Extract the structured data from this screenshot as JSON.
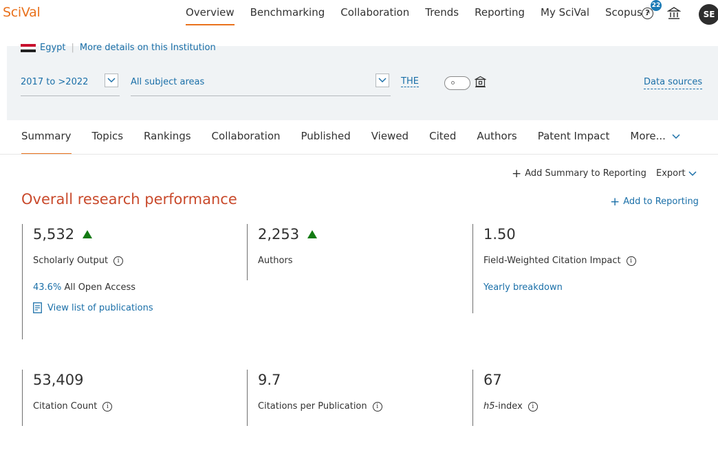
{
  "app": {
    "logo": "SciVal"
  },
  "nav": {
    "items": [
      "Overview",
      "Benchmarking",
      "Collaboration",
      "Trends",
      "Reporting",
      "My SciVal"
    ],
    "scopus": "Scopus",
    "scopus_ext": "↗",
    "help_badge": "22",
    "avatar": "SE"
  },
  "filters": {
    "country": "Egypt",
    "details_link": "More details on this Institution",
    "year_range": "2017 to >2022",
    "subject": "All subject areas",
    "ranking": "THE",
    "data_sources": "Data sources"
  },
  "tabs": {
    "items": [
      "Summary",
      "Topics",
      "Rankings",
      "Collaboration",
      "Published",
      "Viewed",
      "Cited",
      "Authors",
      "Patent Impact"
    ],
    "more": "More..."
  },
  "actions": {
    "add_summary": "Add Summary to Reporting",
    "export": "Export",
    "add_reporting": "Add to Reporting"
  },
  "section": {
    "title": "Overall research performance"
  },
  "metrics": {
    "scholarly_output": {
      "value": "5,532",
      "label": "Scholarly Output",
      "oa_pct": "43.6%",
      "oa_label": "All Open Access",
      "link": "View list of publications"
    },
    "authors": {
      "value": "2,253",
      "label": "Authors"
    },
    "fwci": {
      "value": "1.50",
      "label": "Field-Weighted Citation Impact",
      "link": "Yearly breakdown"
    },
    "citation_count": {
      "value": "53,409",
      "label": "Citation Count"
    },
    "citations_per_pub": {
      "value": "9.7",
      "label": "Citations per Publication"
    },
    "h5": {
      "value": "67",
      "label_italic": "h5",
      "label_rest": "-index"
    }
  },
  "colors": {
    "accent": "#e9711c",
    "link": "#1a6fa8",
    "title": "#c94a2c",
    "trend_up": "#127a12"
  },
  "icons": [
    "help-icon",
    "institution-icon",
    "chevron-down-icon",
    "info-icon",
    "document-icon",
    "plus-icon",
    "up-triangle-icon"
  ]
}
